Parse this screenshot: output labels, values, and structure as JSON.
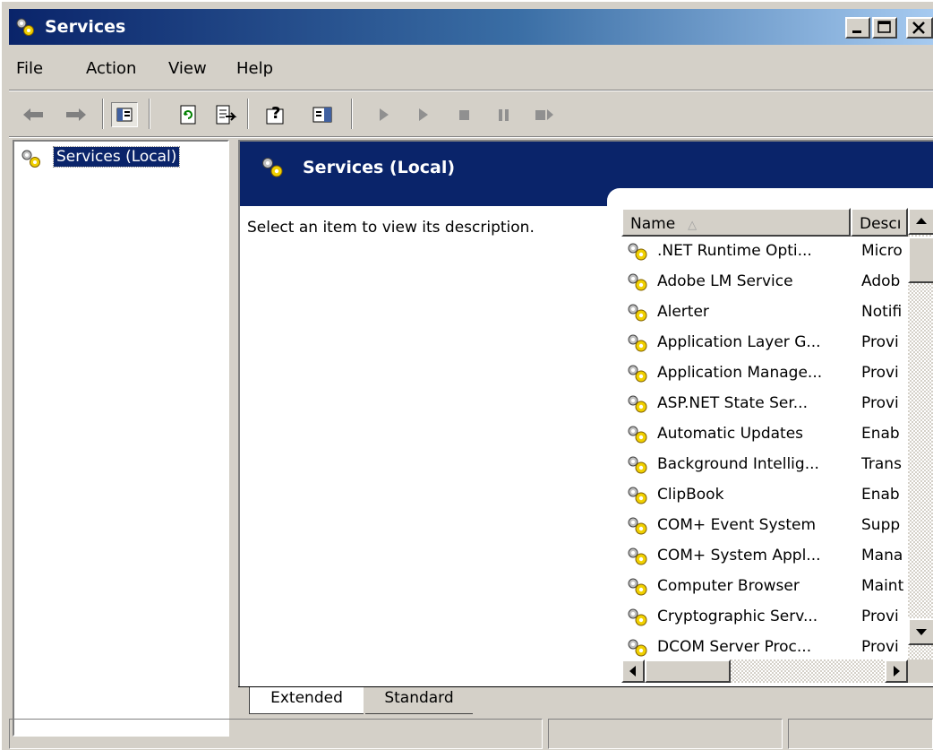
{
  "window": {
    "title": "Services"
  },
  "menu": [
    {
      "label": "File"
    },
    {
      "label": "Action"
    },
    {
      "label": "View"
    },
    {
      "label": "Help"
    }
  ],
  "toolbar": {
    "icons": [
      "back-arrow-icon",
      "forward-arrow-icon",
      "show-hide-console-tree-icon",
      "refresh-icon",
      "export-list-icon",
      "help-icon",
      "show-hide-action-pane-icon",
      "start-service-icon",
      "start-service-alt-icon",
      "stop-service-icon",
      "pause-service-icon",
      "restart-service-icon"
    ]
  },
  "tree": {
    "root_label": "Services (Local)"
  },
  "details": {
    "header_title": "Services (Local)",
    "description_prompt": "Select an item to view its description."
  },
  "list": {
    "columns": {
      "name": "Name",
      "name_sort_indicator": "△",
      "description": "Descı"
    },
    "rows": [
      {
        "name": ".NET Runtime Opti...",
        "desc": "Micro"
      },
      {
        "name": "Adobe LM Service",
        "desc": "Adob"
      },
      {
        "name": "Alerter",
        "desc": "Notifi"
      },
      {
        "name": "Application Layer G...",
        "desc": "Provi"
      },
      {
        "name": "Application Manage...",
        "desc": "Provi"
      },
      {
        "name": "ASP.NET State Ser...",
        "desc": "Provi"
      },
      {
        "name": "Automatic Updates",
        "desc": "Enab"
      },
      {
        "name": "Background Intellig...",
        "desc": "Trans"
      },
      {
        "name": "ClipBook",
        "desc": "Enab"
      },
      {
        "name": "COM+ Event System",
        "desc": "Supp"
      },
      {
        "name": "COM+ System Appl...",
        "desc": "Mana"
      },
      {
        "name": "Computer Browser",
        "desc": "Maint"
      },
      {
        "name": "Cryptographic Serv...",
        "desc": "Provi"
      },
      {
        "name": "DCOM Server Proc...",
        "desc": "Provi"
      }
    ]
  },
  "tabs": [
    {
      "label": "Extended"
    },
    {
      "label": "Standard"
    }
  ],
  "colors": {
    "title_gradient_start": "#0a246a",
    "title_gradient_end": "#a6caf0",
    "header_bg": "#0a246a",
    "face": "#d4d0c8"
  }
}
